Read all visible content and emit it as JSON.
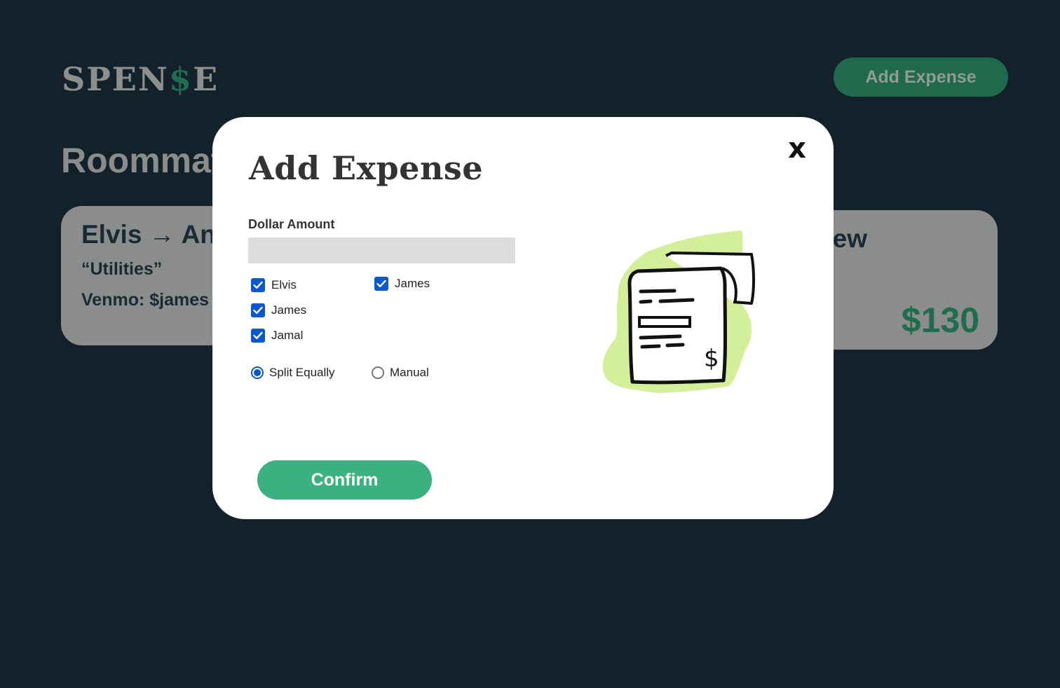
{
  "app": {
    "logo_prefix": "SPEN",
    "logo_dollar": "$",
    "logo_suffix": "E",
    "add_expense_label": "Add Expense",
    "section_title": "Roommat",
    "accent_color": "#3bb081",
    "brand_dark_green": "#1f6c4e",
    "background_color": "#13212a"
  },
  "cards": [
    {
      "name": "Elvis → An",
      "note": "“Utilities”",
      "venmo": "Venmo: $james"
    },
    {
      "name": "ew",
      "amount": "$130"
    }
  ],
  "modal": {
    "title": "Add Expense",
    "close_label": "x",
    "dollar_amount_label": "Dollar Amount",
    "dollar_amount_value": "",
    "dollar_amount_placeholder": "",
    "people": [
      {
        "label": "Elvis",
        "checked": true
      },
      {
        "label": "James",
        "checked": true
      },
      {
        "label": "Jamal",
        "checked": true
      },
      {
        "label": "James",
        "checked": true
      }
    ],
    "split_options": [
      {
        "label": "Split Equally",
        "selected": true
      },
      {
        "label": "Manual",
        "selected": false
      }
    ],
    "confirm_label": "Confirm",
    "illustration_icon": "receipt-icon",
    "illustration_symbol": "$",
    "illustration_blob_color": "#d4ef9a"
  }
}
